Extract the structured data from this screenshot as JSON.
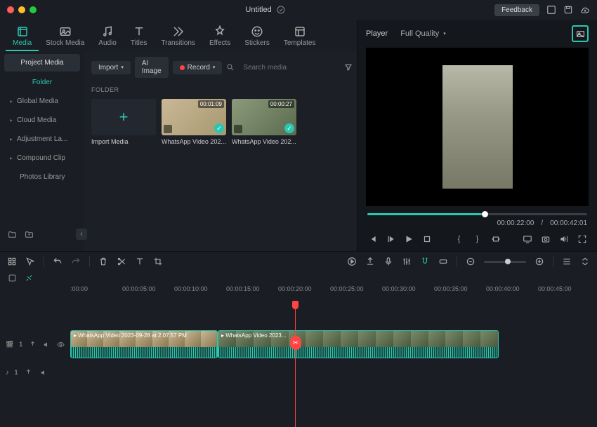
{
  "titlebar": {
    "title": "Untitled",
    "feedback": "Feedback"
  },
  "tabs": {
    "media": "Media",
    "stock": "Stock Media",
    "audio": "Audio",
    "titles": "Titles",
    "transitions": "Transitions",
    "effects": "Effects",
    "stickers": "Stickers",
    "templates": "Templates"
  },
  "sidebar": {
    "project": "Project Media",
    "folder": "Folder",
    "global": "Global Media",
    "cloud": "Cloud Media",
    "adjustment": "Adjustment La...",
    "compound": "Compound Clip",
    "photos": "Photos Library"
  },
  "toolbar": {
    "import": "Import",
    "aiimage": "AI Image",
    "record": "Record",
    "search_placeholder": "Search media"
  },
  "media": {
    "section": "FOLDER",
    "import_label": "Import Media",
    "clip1_dur": "00:01:09",
    "clip1_label": "WhatsApp Video 202...",
    "clip2_dur": "00:00:27",
    "clip2_label": "WhatsApp Video 202..."
  },
  "player": {
    "label": "Player",
    "quality": "Full Quality",
    "current": "00:00:22:00",
    "sep": "/",
    "total": "00:00:42:01"
  },
  "ruler": [
    ":00:00",
    "00:00:05:00",
    "00:00:10:00",
    "00:00:15:00",
    "00:00:20:00",
    "00:00:25:00",
    "00:00:30:00",
    "00:00:35:00",
    "00:00:40:00",
    "00:00:45:00"
  ],
  "tracks": {
    "video": "1",
    "audio": "1",
    "clip1": "WhatsApp Video 2023-09-28 at 2.07.57 PM",
    "clip2": "WhatsApp Video 2023..."
  }
}
